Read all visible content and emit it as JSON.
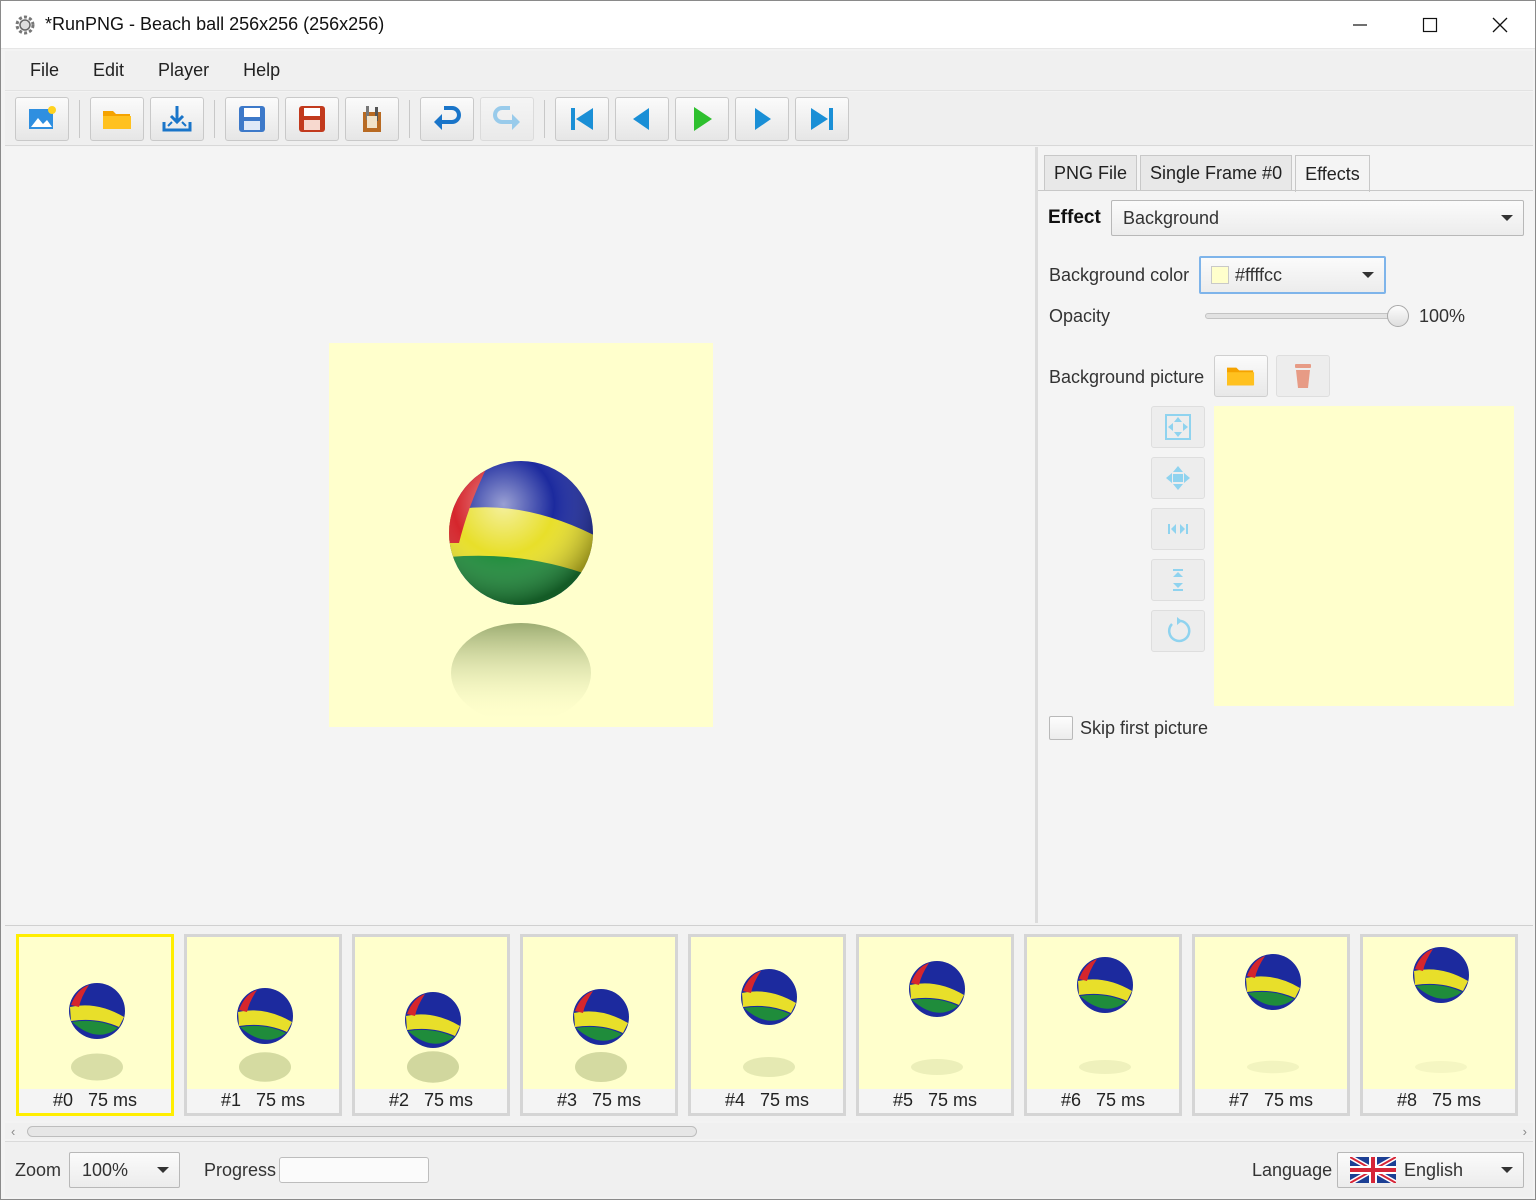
{
  "window": {
    "title": "*RunPNG - Beach ball 256x256 (256x256)"
  },
  "menu": [
    "File",
    "Edit",
    "Player",
    "Help"
  ],
  "toolbar": {
    "buttons": [
      "new-image",
      "open",
      "import",
      "save",
      "save-as",
      "tools",
      "undo",
      "redo",
      "first-frame",
      "previous-frame",
      "play",
      "next-frame",
      "last-frame"
    ]
  },
  "tabs": [
    "PNG File",
    "Single Frame #0",
    "Effects"
  ],
  "active_tab": "Effects",
  "effects": {
    "effect_label": "Effect",
    "effect_value": "Background",
    "bg_color_label": "Background color",
    "bg_color_value": "#ffffcc",
    "bg_color_text": "#ffffcc",
    "opacity_label": "Opacity",
    "opacity_value": "100%",
    "opacity_fraction": 1.0,
    "bg_picture_label": "Background picture",
    "skip_first_label": "Skip first picture",
    "skip_first_checked": false
  },
  "frames": [
    {
      "label": "#0   75 ms"
    },
    {
      "label": "#1   75 ms"
    },
    {
      "label": "#2   75 ms"
    },
    {
      "label": "#3   75 ms"
    },
    {
      "label": "#4   75 ms"
    },
    {
      "label": "#5   75 ms"
    },
    {
      "label": "#6   75 ms"
    },
    {
      "label": "#7   75 ms"
    },
    {
      "label": "#8   75 ms"
    }
  ],
  "selected_frame": 0,
  "status": {
    "zoom_label": "Zoom",
    "zoom_value": "100%",
    "progress_label": "Progress",
    "progress_fraction": 0,
    "language_label": "Language",
    "language_value": "English"
  },
  "colors": {
    "canvas_bg": "#ffffcc",
    "selected_frame_border": "#ffee00",
    "accent_blue": "#1aa3e0",
    "play_green": "#2ec02e"
  }
}
